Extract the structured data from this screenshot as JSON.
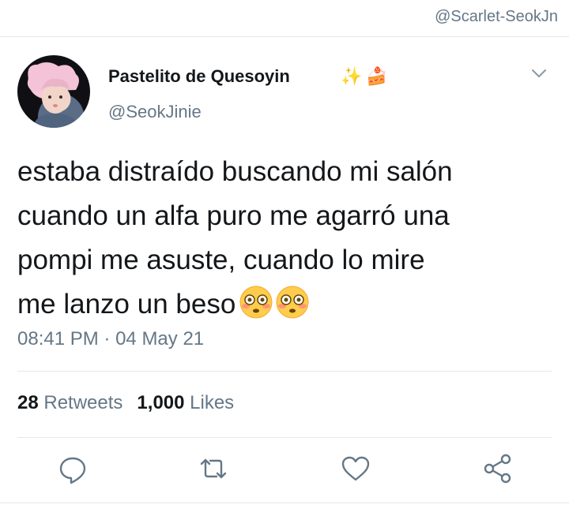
{
  "watermark": "@Scarlet-SeokJn",
  "author": {
    "display_name": "Pastelito de Quesoyin",
    "name_emoji_1": "✨",
    "name_emoji_2": "🍰",
    "handle": "@SeokJinie"
  },
  "tweet": {
    "lines": [
      "estaba distraído buscando mi salón",
      "cuando un alfa puro me agarró una",
      "pompi me asuste, cuando lo mire",
      "me lanzo un beso"
    ],
    "trailing_emoji": [
      "flushed-face",
      "flushed-face"
    ],
    "time": "08:41 PM",
    "separator": "·",
    "date": "04 May 21"
  },
  "stats": {
    "retweets_count": "28",
    "retweets_label": "Retweets",
    "likes_count": "1,000",
    "likes_label": "Likes"
  },
  "actions": [
    "reply-icon",
    "retweet-icon",
    "like-icon",
    "share-icon"
  ],
  "colors": {
    "text": "#14171a",
    "secondary": "#657786",
    "divider": "#e1e8ed"
  }
}
